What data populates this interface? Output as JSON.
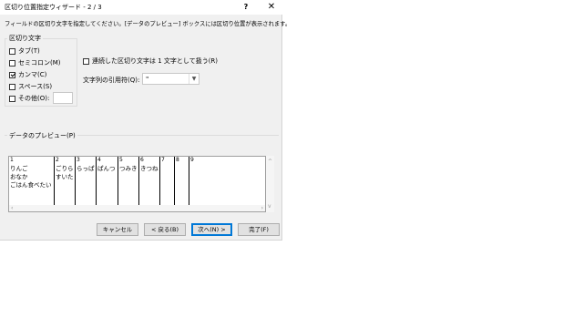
{
  "window": {
    "title": "区切り位置指定ウィザード - 2 / 3",
    "help_label": "?",
    "close_label": "✕"
  },
  "instruction": "フィールドの区切り文字を指定してください。[データのプレビュー] ボックスには区切り位置が表示されます。",
  "delimiters": {
    "group_label": "区切り文字",
    "options": [
      {
        "label": "タブ(T)",
        "checked": false
      },
      {
        "label": "セミコロン(M)",
        "checked": false
      },
      {
        "label": "カンマ(C)",
        "checked": true
      },
      {
        "label": "スペース(S)",
        "checked": false
      },
      {
        "label": "その他(O):",
        "checked": false
      }
    ],
    "other_value": ""
  },
  "consecutive": {
    "label": "連続した区切り文字は 1 文字として扱う(R)",
    "checked": false
  },
  "text_qualifier": {
    "label": "文字列の引用符(Q):",
    "value": "\""
  },
  "preview": {
    "label": "データのプレビュー(P)",
    "columns": [
      {
        "number": "1",
        "cells": [
          "りんご",
          "おなか",
          "ごはん食べたい"
        ]
      },
      {
        "number": "2",
        "cells": [
          "ごりら",
          "すいた"
        ]
      },
      {
        "number": "3",
        "cells": [
          "らっぱ"
        ]
      },
      {
        "number": "4",
        "cells": [
          "ぱんつ"
        ]
      },
      {
        "number": "5",
        "cells": [
          "つみき"
        ]
      },
      {
        "number": "6",
        "cells": [
          "きつね"
        ]
      },
      {
        "number": "7",
        "cells": []
      },
      {
        "number": "8",
        "cells": []
      },
      {
        "number": "9",
        "cells": []
      }
    ]
  },
  "buttons": {
    "cancel": "キャンセル",
    "back": "< 戻る(B)",
    "next": "次へ(N) >",
    "finish": "完了(F)"
  }
}
